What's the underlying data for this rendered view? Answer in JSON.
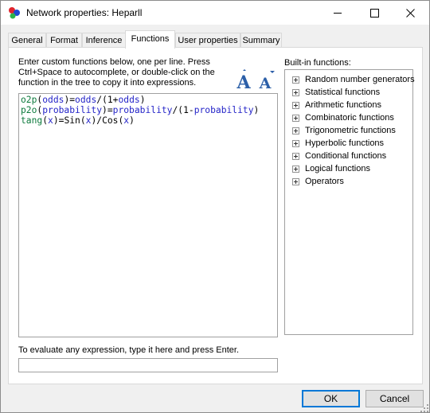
{
  "window": {
    "title": "Network properties: Heparll",
    "icon": "genie-network-icon"
  },
  "tabs": [
    {
      "label": "General"
    },
    {
      "label": "Format"
    },
    {
      "label": "Inference"
    },
    {
      "label": "Functions",
      "active": true
    },
    {
      "label": "User properties"
    },
    {
      "label": "Summary"
    }
  ],
  "functions_tab": {
    "instructions": "Enter custom functions below, one per line. Press Ctrl+Space to autocomplete, or double-click on the function in the tree to copy it into expressions.",
    "font_increase_icon": "font-increase-icon",
    "font_decrease_icon": "font-decrease-icon",
    "code_lines": [
      [
        "o2p",
        "(",
        "odds",
        ")=",
        "odds",
        "/(1+",
        "odds",
        ")"
      ],
      [
        "p2o",
        "(",
        "probability",
        ")=",
        "probability",
        "/(1-",
        "probability",
        ")"
      ],
      [
        "tang",
        "(",
        "x",
        ")=Sin(",
        "x",
        ")/Cos(",
        "x",
        ")"
      ]
    ],
    "builtin_label": "Built-in functions:",
    "builtin_functions": [
      "Random number generators",
      "Statistical functions",
      "Arithmetic functions",
      "Combinatoric functions",
      "Trigonometric functions",
      "Hyperbolic functions",
      "Conditional functions",
      "Logical functions",
      "Operators"
    ],
    "evaluate_label": "To evaluate any expression, type it here and press Enter.",
    "evaluate_value": ""
  },
  "buttons": {
    "ok": "OK",
    "cancel": "Cancel"
  },
  "colors": {
    "function_name": "#0c7a3c",
    "parameter": "#2424c8",
    "accent": "#0078d7"
  }
}
